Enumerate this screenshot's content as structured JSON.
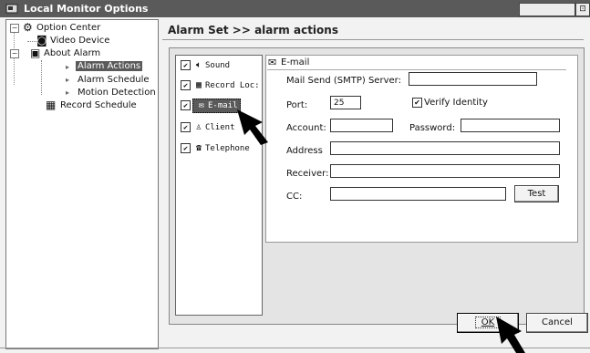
{
  "window": {
    "title": "Local Monitor Options"
  },
  "tree": {
    "root": "Option Center",
    "items": [
      {
        "label": "Video Device",
        "icon": "camera-icon"
      },
      {
        "label": "About Alarm",
        "icon": "alarm-icon",
        "children": [
          "Alarm Actions",
          "Alarm Schedule",
          "Motion Detection"
        ]
      },
      {
        "label": "Record Schedule",
        "icon": "record-icon"
      }
    ],
    "selected": "Alarm Actions"
  },
  "breadcrumb": "Alarm Set >> alarm actions",
  "actions": [
    {
      "label": "Sound",
      "checked": true,
      "icon": "speaker-icon"
    },
    {
      "label": "Record Loc:",
      "checked": true,
      "icon": "record-icon"
    },
    {
      "label": "E-mail",
      "checked": true,
      "icon": "envelope-icon",
      "selected": true
    },
    {
      "label": "Client",
      "checked": true,
      "icon": "client-icon"
    },
    {
      "label": "Telephone",
      "checked": true,
      "icon": "telephone-icon"
    }
  ],
  "email_form": {
    "header": "E-mail",
    "smtp_label": "Mail Send (SMTP) Server:",
    "smtp_value": "",
    "port_label": "Port:",
    "port_value": "25",
    "verify_label": "Verify Identity",
    "verify_checked": true,
    "account_label": "Account:",
    "account_value": "",
    "password_label": "Password:",
    "password_value": "",
    "address_label": "Address",
    "address_value": "",
    "receiver_label": "Receiver:",
    "receiver_value": "",
    "cc_label": "CC:",
    "cc_value": "",
    "test_label": "Test"
  },
  "footer": {
    "ok_label": "OK",
    "cancel_label": "Cancel"
  }
}
